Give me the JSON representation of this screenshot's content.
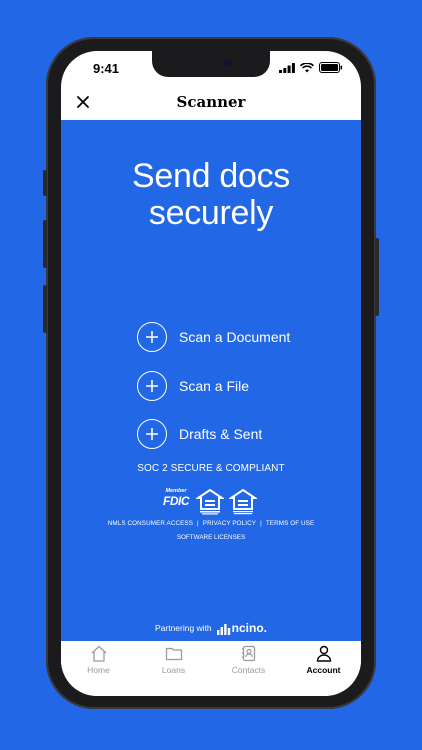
{
  "status_bar": {
    "time": "9:41"
  },
  "header": {
    "title": "Scanner"
  },
  "main": {
    "headline_line1": "Send docs",
    "headline_line2": "securely",
    "actions": [
      {
        "label": "Scan a Document"
      },
      {
        "label": "Scan a File"
      },
      {
        "label": "Drafts & Sent"
      }
    ],
    "compliance": "SOC 2 SECURE & COMPLIANT",
    "fdic": {
      "member": "Member",
      "name": "FDIC"
    },
    "links": [
      "NMLS CONSUMER ACCESS",
      "PRIVACY POLICY",
      "TERMS OF USE"
    ],
    "link_separator": "|",
    "software_licenses": "SOFTWARE LICENSES",
    "partner": {
      "prefix": "Partnering with",
      "brand": "ncino."
    }
  },
  "tabbar": {
    "tabs": [
      {
        "label": "Home",
        "icon": "home-icon"
      },
      {
        "label": "Loans",
        "icon": "folder-icon"
      },
      {
        "label": "Contacts",
        "icon": "contacts-icon"
      },
      {
        "label": "Account",
        "icon": "person-icon",
        "active": true
      }
    ]
  },
  "colors": {
    "background": "#2267e5",
    "panel": "#2267e5",
    "text_on_blue": "#ffffff",
    "tab_inactive": "#9a9aa0"
  }
}
